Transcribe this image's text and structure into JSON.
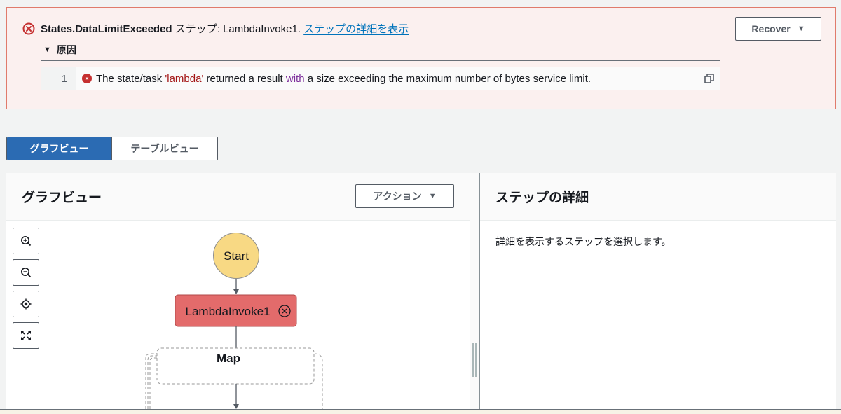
{
  "error_banner": {
    "error_code": "States.DataLimitExceeded",
    "step_label": " ステップ: LambdaInvoke1. ",
    "details_link": "ステップの詳細を表示",
    "cause_label": "原因",
    "code": {
      "line_number": "1",
      "text_before": "The state/task ",
      "string_literal": "'lambda'",
      "text_mid": " returned a result ",
      "keyword": "with",
      "text_after": " a size exceeding the maximum number of bytes service limit."
    },
    "recover_button": "Recover",
    "colors": {
      "border": "#e07b6c",
      "background": "#fbf0ef",
      "error_icon": "#c53030"
    }
  },
  "view_toggle": {
    "options": [
      "グラフビュー",
      "テーブルビュー"
    ],
    "selected": "グラフビュー",
    "active_color": "#2b6bb3"
  },
  "graph_panel": {
    "title": "グラフビュー",
    "action_button": "アクション",
    "zoom_controls": [
      "zoom-in-icon",
      "zoom-out-icon",
      "center-icon",
      "fit-icon"
    ],
    "nodes": {
      "start": "Start",
      "task": "LambdaInvoke1",
      "map": "Map"
    },
    "colors": {
      "start": "#f8d984",
      "failed_task": "#e36b6b"
    }
  },
  "details_panel": {
    "title": "ステップの詳細",
    "placeholder": "詳細を表示するステップを選択します。"
  }
}
